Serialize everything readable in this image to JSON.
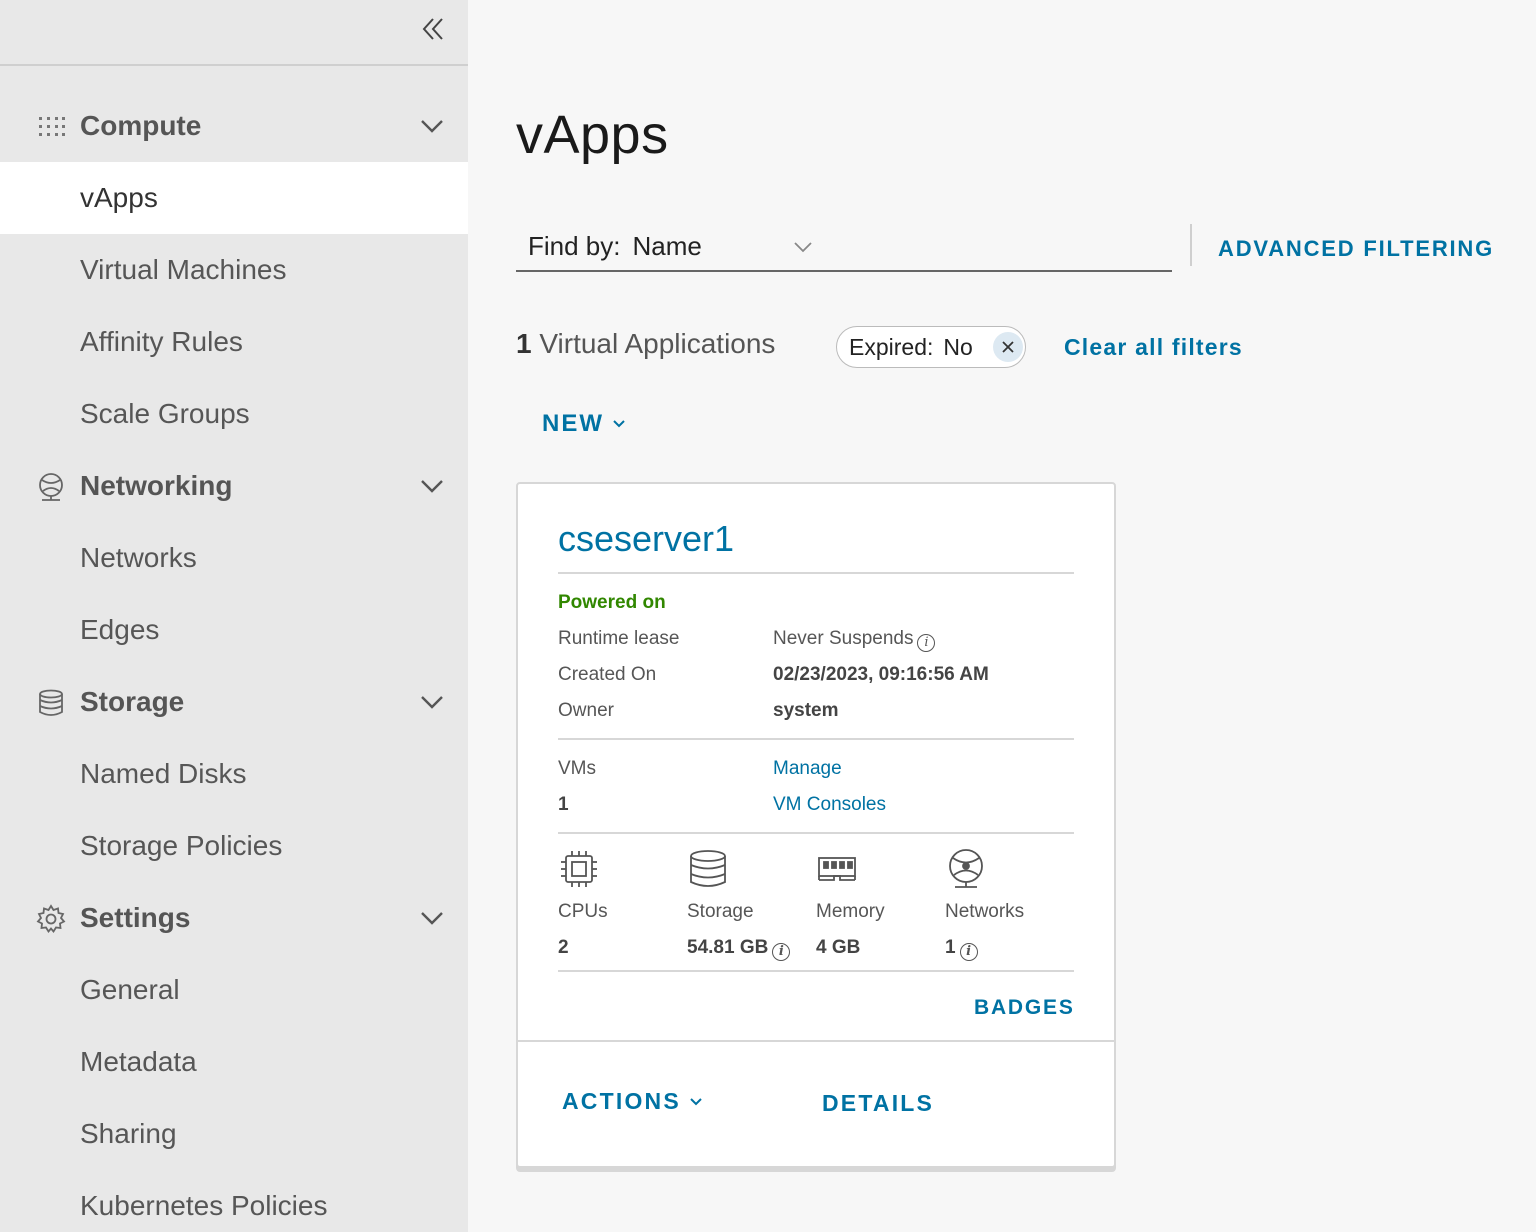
{
  "sidebar": {
    "collapse_icon": "double-chevron-left-icon",
    "groups": [
      {
        "label": "Compute",
        "icon": "grid-icon",
        "items": [
          "vApps",
          "Virtual Machines",
          "Affinity Rules",
          "Scale Groups"
        ]
      },
      {
        "label": "Networking",
        "icon": "network-globe-icon",
        "items": [
          "Networks",
          "Edges"
        ]
      },
      {
        "label": "Storage",
        "icon": "database-icon",
        "items": [
          "Named Disks",
          "Storage Policies"
        ]
      },
      {
        "label": "Settings",
        "icon": "gear-icon",
        "items": [
          "General",
          "Metadata",
          "Sharing",
          "Kubernetes Policies"
        ]
      }
    ],
    "active_item": "vApps"
  },
  "main": {
    "title": "vApps",
    "find_by": {
      "label": "Find by:",
      "value": "Name"
    },
    "advanced_filtering": "ADVANCED FILTERING",
    "count": {
      "number": "1",
      "label": "Virtual Applications"
    },
    "filter_chip": {
      "key": "Expired:",
      "value": "No"
    },
    "clear_filters": "Clear all filters",
    "new_button": "NEW"
  },
  "card": {
    "name": "cseserver1",
    "status": "Powered on",
    "runtime_lease_label": "Runtime lease",
    "runtime_lease_value": "Never Suspends",
    "created_label": "Created On",
    "created_value": "02/23/2023, 09:16:56 AM",
    "owner_label": "Owner",
    "owner_value": "system",
    "vms_label": "VMs",
    "vms_count": "1",
    "manage_link": "Manage",
    "vm_consoles_link": "VM Consoles",
    "resources": {
      "cpus": {
        "label": "CPUs",
        "value": "2"
      },
      "storage": {
        "label": "Storage",
        "value": "54.81 GB"
      },
      "memory": {
        "label": "Memory",
        "value": "4 GB"
      },
      "networks": {
        "label": "Networks",
        "value": "1"
      }
    },
    "badges": "BADGES",
    "actions": "ACTIONS",
    "details": "DETAILS"
  },
  "colors": {
    "accent": "#0072a3",
    "status_on": "#318700",
    "sidebar_bg": "#e8e8e8"
  }
}
